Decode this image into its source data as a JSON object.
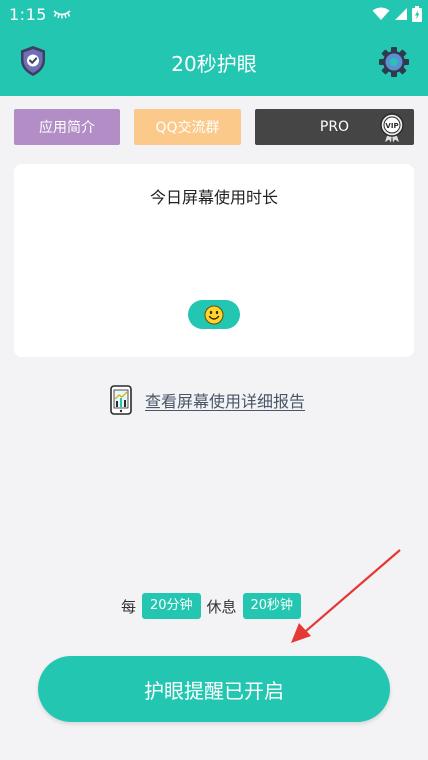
{
  "status_bar": {
    "time": "1:15"
  },
  "app_bar": {
    "title": "20秒护眼"
  },
  "buttons": {
    "intro": "应用简介",
    "qq_group": "QQ交流群",
    "pro": "PRO",
    "vip_badge": "VIP"
  },
  "card": {
    "title": "今日屏幕使用时长"
  },
  "report_link": "查看屏幕使用详细报告",
  "interval": {
    "prefix": "每",
    "work_time": "20分钟",
    "middle": "休息",
    "rest_time": "20秒钟"
  },
  "main_button": "护眼提醒已开启",
  "colors": {
    "accent": "#23c7b1",
    "intro": "#b38dc6",
    "qq": "#fbc98a",
    "pro": "#454545",
    "annotation_arrow": "#e53935"
  }
}
